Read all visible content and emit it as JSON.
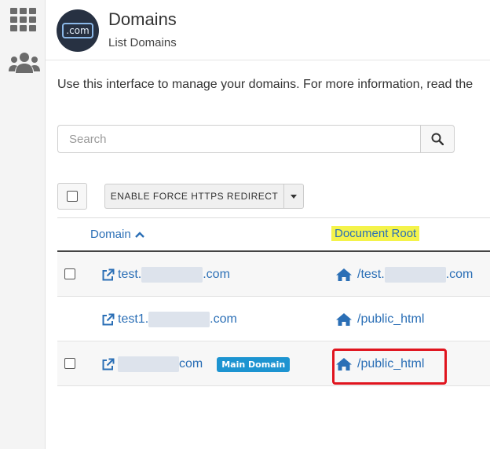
{
  "rail": {
    "icons": [
      "grid-icon",
      "users-icon"
    ]
  },
  "header": {
    "icon_text": ".com",
    "title": "Domains",
    "subtitle": "List Domains"
  },
  "intro_text": "Use this interface to manage your domains. For more information, read the",
  "search": {
    "placeholder": "Search",
    "value": ""
  },
  "toolbar": {
    "force_https_label": "ENABLE FORCE HTTPS REDIRECT"
  },
  "table": {
    "columns": {
      "domain": "Domain",
      "document_root": "Document Root"
    },
    "sort": {
      "column": "domain",
      "direction": "ascending"
    },
    "rows": [
      {
        "domain_prefix": "test.",
        "domain_suffix": ".com",
        "root_prefix": "/test.",
        "root_suffix": ".com",
        "has_checkbox": true,
        "badge": ""
      },
      {
        "domain_prefix": "test1.",
        "domain_suffix": ".com",
        "root_prefix": "/public_html",
        "root_suffix": "",
        "has_checkbox": false,
        "badge": ""
      },
      {
        "domain_prefix": "",
        "domain_suffix": "com",
        "root_prefix": "/public_html",
        "root_suffix": "",
        "has_checkbox": true,
        "badge": "Main Domain"
      }
    ]
  },
  "colors": {
    "link": "#2b6fb6",
    "badge": "#1d94d1",
    "highlight": "#f4f34a",
    "annotation_box": "#e0141e",
    "header_icon_bg": "#273142"
  }
}
